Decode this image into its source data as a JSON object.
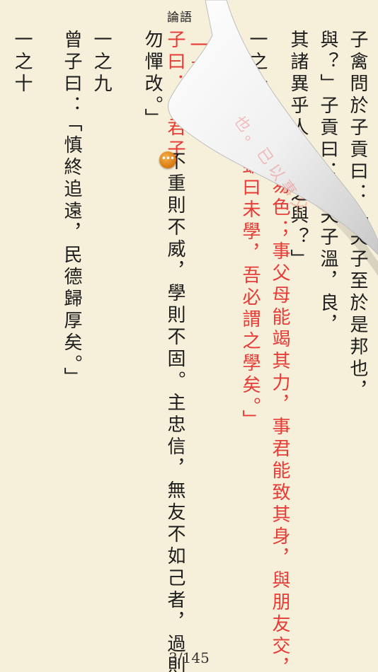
{
  "header": {
    "book_title": "論語"
  },
  "columns": [
    {
      "id": "c1",
      "text": "子禽問於子貢曰：「夫子至於是邦也，",
      "red": false
    },
    {
      "id": "c2",
      "text": "與？」子貢曰：「夫子溫，良，",
      "red": false
    },
    {
      "id": "c3",
      "text": "其諸異乎人之求之與？」",
      "red": false
    },
    {
      "id": "c4",
      "text": "易色；事父母能竭其力，事君能致其身，與朋友交，",
      "red": true
    },
    {
      "id": "c5",
      "text": "雖曰未學，吾必謂之學矣。」",
      "red": true
    },
    {
      "id": "c6",
      "text": "一之十一",
      "red": false
    },
    {
      "id": "c7",
      "text": "子曰：",
      "red": false
    },
    {
      "id": "c8",
      "text": "一之",
      "red": true
    },
    {
      "id": "c9",
      "text": "子曰：「君子",
      "red": true
    },
    {
      "id": "c9b",
      "text": "不重則不威，學則不固。主忠信，無友不如己者，過則",
      "red": false
    },
    {
      "id": "c10",
      "text": "勿憚改。」",
      "red": false
    },
    {
      "id": "c11",
      "text": "一之九",
      "red": false
    },
    {
      "id": "c12",
      "text": "曾子曰：",
      "red": false
    },
    {
      "id": "c13",
      "text": "「慎終追遠，民德歸厚矣。」",
      "red": false
    },
    {
      "id": "c14",
      "text": "一之十",
      "red": false
    }
  ],
  "back_text": "也。已以事父",
  "note_icon": "ellipsis-note-icon",
  "page_indicator": "3/145",
  "colors": {
    "background": "#f6efd9",
    "text": "#1c1c1c",
    "highlight_red": "#e63b37",
    "note_badge": "#e07a12"
  }
}
